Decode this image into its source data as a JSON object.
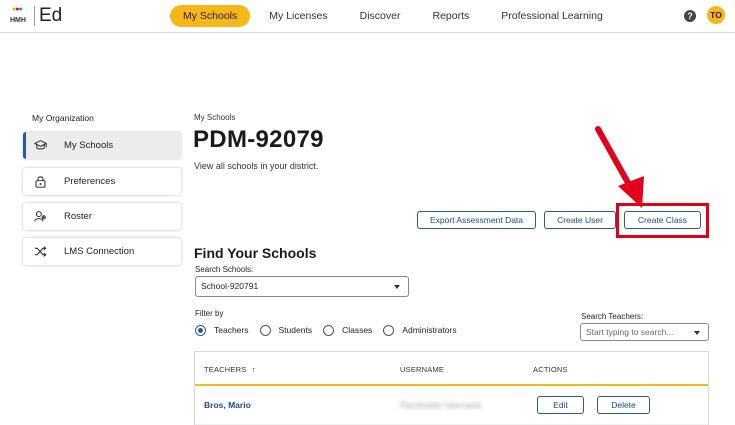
{
  "header": {
    "logo_small": "HMH",
    "logo_main": "Ed",
    "nav": [
      {
        "label": "My Schools",
        "active": true
      },
      {
        "label": "My Licenses",
        "active": false
      },
      {
        "label": "Discover",
        "active": false
      },
      {
        "label": "Reports",
        "active": false
      },
      {
        "label": "Professional Learning",
        "active": false
      }
    ],
    "help_icon": "question-circle-icon",
    "help_glyph": "?",
    "avatar_initials": "TO"
  },
  "sidebar": {
    "title": "My Organization",
    "items": [
      {
        "label": "My Schools",
        "icon": "graduation-cap-icon",
        "active": true
      },
      {
        "label": "Preferences",
        "icon": "lock-icon",
        "active": false
      },
      {
        "label": "Roster",
        "icon": "users-icon",
        "active": false
      },
      {
        "label": "LMS Connection",
        "icon": "shuffle-icon",
        "active": false
      }
    ]
  },
  "main": {
    "breadcrumb": "My Schools",
    "title": "PDM-92079",
    "subtitle": "View all schools in your district.",
    "buttons": {
      "export": "Export Assessment Data",
      "create_user": "Create User",
      "create_class": "Create Class"
    },
    "find_title": "Find Your Schools",
    "search_schools_label": "Search Schools:",
    "search_schools_value": "School-920791",
    "filter_label": "Filter by",
    "filters": [
      {
        "label": "Teachers",
        "checked": true
      },
      {
        "label": "Students",
        "checked": false
      },
      {
        "label": "Classes",
        "checked": false
      },
      {
        "label": "Administrators",
        "checked": false
      }
    ],
    "search_teachers_label": "Search Teachers:",
    "search_teachers_placeholder": "Start typing to search...",
    "table": {
      "columns": [
        "TEACHERS",
        "USERNAME",
        "ACTIONS"
      ],
      "sort_glyph": "↑",
      "rows": [
        {
          "name": "Bros, Mario",
          "username": "Placeholder Username",
          "actions": [
            "Edit",
            "Delete"
          ]
        }
      ]
    }
  },
  "colors": {
    "accent": "#f7b718",
    "link": "#1b4a8a",
    "annotation": "#e3001b"
  }
}
